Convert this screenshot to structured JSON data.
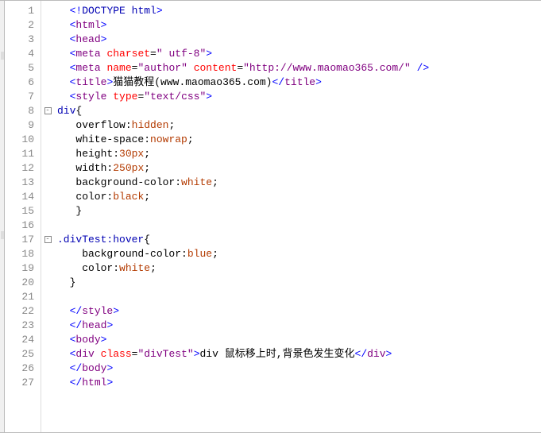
{
  "lines": [
    {
      "num": "1",
      "fold": "",
      "tokens": [
        [
          "  ",
          "text"
        ],
        [
          "<",
          "angle"
        ],
        [
          "!",
          "bang"
        ],
        [
          "DOCTYPE html",
          "sel"
        ],
        [
          ">",
          "angle"
        ]
      ]
    },
    {
      "num": "2",
      "fold": "",
      "tokens": [
        [
          "  ",
          "text"
        ],
        [
          "<",
          "angle"
        ],
        [
          "html",
          "tag"
        ],
        [
          ">",
          "angle"
        ]
      ]
    },
    {
      "num": "3",
      "fold": "",
      "tokens": [
        [
          "  ",
          "text"
        ],
        [
          "<",
          "angle"
        ],
        [
          "head",
          "tag"
        ],
        [
          ">",
          "angle"
        ]
      ]
    },
    {
      "num": "4",
      "fold": "",
      "tokens": [
        [
          "  ",
          "text"
        ],
        [
          "<",
          "angle"
        ],
        [
          "meta ",
          "tag"
        ],
        [
          "charset",
          "attr"
        ],
        [
          "=",
          "eq"
        ],
        [
          "\" utf-8\"",
          "str"
        ],
        [
          ">",
          "angle"
        ]
      ]
    },
    {
      "num": "5",
      "fold": "",
      "tokens": [
        [
          "  ",
          "text"
        ],
        [
          "<",
          "angle"
        ],
        [
          "meta ",
          "tag"
        ],
        [
          "name",
          "attr"
        ],
        [
          "=",
          "eq"
        ],
        [
          "\"author\"",
          "str"
        ],
        [
          " ",
          "text"
        ],
        [
          "content",
          "attr"
        ],
        [
          "=",
          "eq"
        ],
        [
          "\"http://www.maomao365.com/\"",
          "str"
        ],
        [
          " />",
          "angle"
        ]
      ]
    },
    {
      "num": "6",
      "fold": "",
      "tokens": [
        [
          "  ",
          "text"
        ],
        [
          "<",
          "angle"
        ],
        [
          "title",
          "tag"
        ],
        [
          ">",
          "angle"
        ],
        [
          "猫猫教程(www.maomao365.com)",
          "text"
        ],
        [
          "</",
          "angle"
        ],
        [
          "title",
          "tag"
        ],
        [
          ">",
          "angle"
        ]
      ]
    },
    {
      "num": "7",
      "fold": "",
      "tokens": [
        [
          "  ",
          "text"
        ],
        [
          "<",
          "angle"
        ],
        [
          "style ",
          "tag"
        ],
        [
          "type",
          "attr"
        ],
        [
          "=",
          "eq"
        ],
        [
          "\"text/css\"",
          "str"
        ],
        [
          ">",
          "angle"
        ]
      ]
    },
    {
      "num": "8",
      "fold": "box",
      "tokens": [
        [
          "div",
          "sel"
        ],
        [
          "{",
          "punct"
        ]
      ]
    },
    {
      "num": "9",
      "fold": "",
      "tokens": [
        [
          "   ",
          "text"
        ],
        [
          "overflow",
          "prop"
        ],
        [
          ":",
          "punct"
        ],
        [
          "hidden",
          "val"
        ],
        [
          ";",
          "punct"
        ]
      ]
    },
    {
      "num": "10",
      "fold": "",
      "tokens": [
        [
          "   ",
          "text"
        ],
        [
          "white-space",
          "prop"
        ],
        [
          ":",
          "punct"
        ],
        [
          "nowrap",
          "val"
        ],
        [
          ";",
          "punct"
        ]
      ]
    },
    {
      "num": "11",
      "fold": "",
      "tokens": [
        [
          "   ",
          "text"
        ],
        [
          "height",
          "prop"
        ],
        [
          ":",
          "punct"
        ],
        [
          "30px",
          "val"
        ],
        [
          ";",
          "punct"
        ]
      ]
    },
    {
      "num": "12",
      "fold": "",
      "tokens": [
        [
          "   ",
          "text"
        ],
        [
          "width",
          "prop"
        ],
        [
          ":",
          "punct"
        ],
        [
          "250px",
          "val"
        ],
        [
          ";",
          "punct"
        ]
      ]
    },
    {
      "num": "13",
      "fold": "",
      "tokens": [
        [
          "   ",
          "text"
        ],
        [
          "background-color",
          "prop"
        ],
        [
          ":",
          "punct"
        ],
        [
          "white",
          "val"
        ],
        [
          ";",
          "punct"
        ]
      ]
    },
    {
      "num": "14",
      "fold": "",
      "tokens": [
        [
          "   ",
          "text"
        ],
        [
          "color",
          "prop"
        ],
        [
          ":",
          "punct"
        ],
        [
          "black",
          "val"
        ],
        [
          ";",
          "punct"
        ]
      ]
    },
    {
      "num": "15",
      "fold": "",
      "tokens": [
        [
          "   ",
          "text"
        ],
        [
          "}",
          "punct"
        ]
      ]
    },
    {
      "num": "16",
      "fold": "",
      "tokens": [
        [
          "",
          "text"
        ]
      ]
    },
    {
      "num": "17",
      "fold": "box",
      "tokens": [
        [
          ".divTest:hover",
          "sel"
        ],
        [
          "{",
          "punct"
        ]
      ]
    },
    {
      "num": "18",
      "fold": "",
      "tokens": [
        [
          "    ",
          "text"
        ],
        [
          "background-color",
          "prop"
        ],
        [
          ":",
          "punct"
        ],
        [
          "blue",
          "val"
        ],
        [
          ";",
          "punct"
        ]
      ]
    },
    {
      "num": "19",
      "fold": "",
      "tokens": [
        [
          "    ",
          "text"
        ],
        [
          "color",
          "prop"
        ],
        [
          ":",
          "punct"
        ],
        [
          "white",
          "val"
        ],
        [
          ";",
          "punct"
        ]
      ]
    },
    {
      "num": "20",
      "fold": "",
      "tokens": [
        [
          "  ",
          "text"
        ],
        [
          "}",
          "punct"
        ]
      ]
    },
    {
      "num": "21",
      "fold": "",
      "tokens": [
        [
          "",
          "text"
        ]
      ]
    },
    {
      "num": "22",
      "fold": "",
      "tokens": [
        [
          "  ",
          "text"
        ],
        [
          "</",
          "angle"
        ],
        [
          "style",
          "tag"
        ],
        [
          ">",
          "angle"
        ]
      ]
    },
    {
      "num": "23",
      "fold": "",
      "tokens": [
        [
          "  ",
          "text"
        ],
        [
          "</",
          "angle"
        ],
        [
          "head",
          "tag"
        ],
        [
          ">",
          "angle"
        ]
      ]
    },
    {
      "num": "24",
      "fold": "",
      "tokens": [
        [
          "  ",
          "text"
        ],
        [
          "<",
          "angle"
        ],
        [
          "body",
          "tag"
        ],
        [
          ">",
          "angle"
        ]
      ]
    },
    {
      "num": "25",
      "fold": "",
      "tokens": [
        [
          "  ",
          "text"
        ],
        [
          "<",
          "angle"
        ],
        [
          "div ",
          "tag"
        ],
        [
          "class",
          "attr"
        ],
        [
          "=",
          "eq"
        ],
        [
          "\"divTest\"",
          "str"
        ],
        [
          ">",
          "angle"
        ],
        [
          "div 鼠标移上时,背景色发生变化",
          "text"
        ],
        [
          "</",
          "angle"
        ],
        [
          "div",
          "tag"
        ],
        [
          ">",
          "angle"
        ]
      ]
    },
    {
      "num": "26",
      "fold": "",
      "tokens": [
        [
          "  ",
          "text"
        ],
        [
          "</",
          "angle"
        ],
        [
          "body",
          "tag"
        ],
        [
          ">",
          "angle"
        ]
      ]
    },
    {
      "num": "27",
      "fold": "",
      "tokens": [
        [
          "  ",
          "text"
        ],
        [
          "</",
          "angle"
        ],
        [
          "html",
          "tag"
        ],
        [
          ">",
          "angle"
        ]
      ]
    }
  ]
}
